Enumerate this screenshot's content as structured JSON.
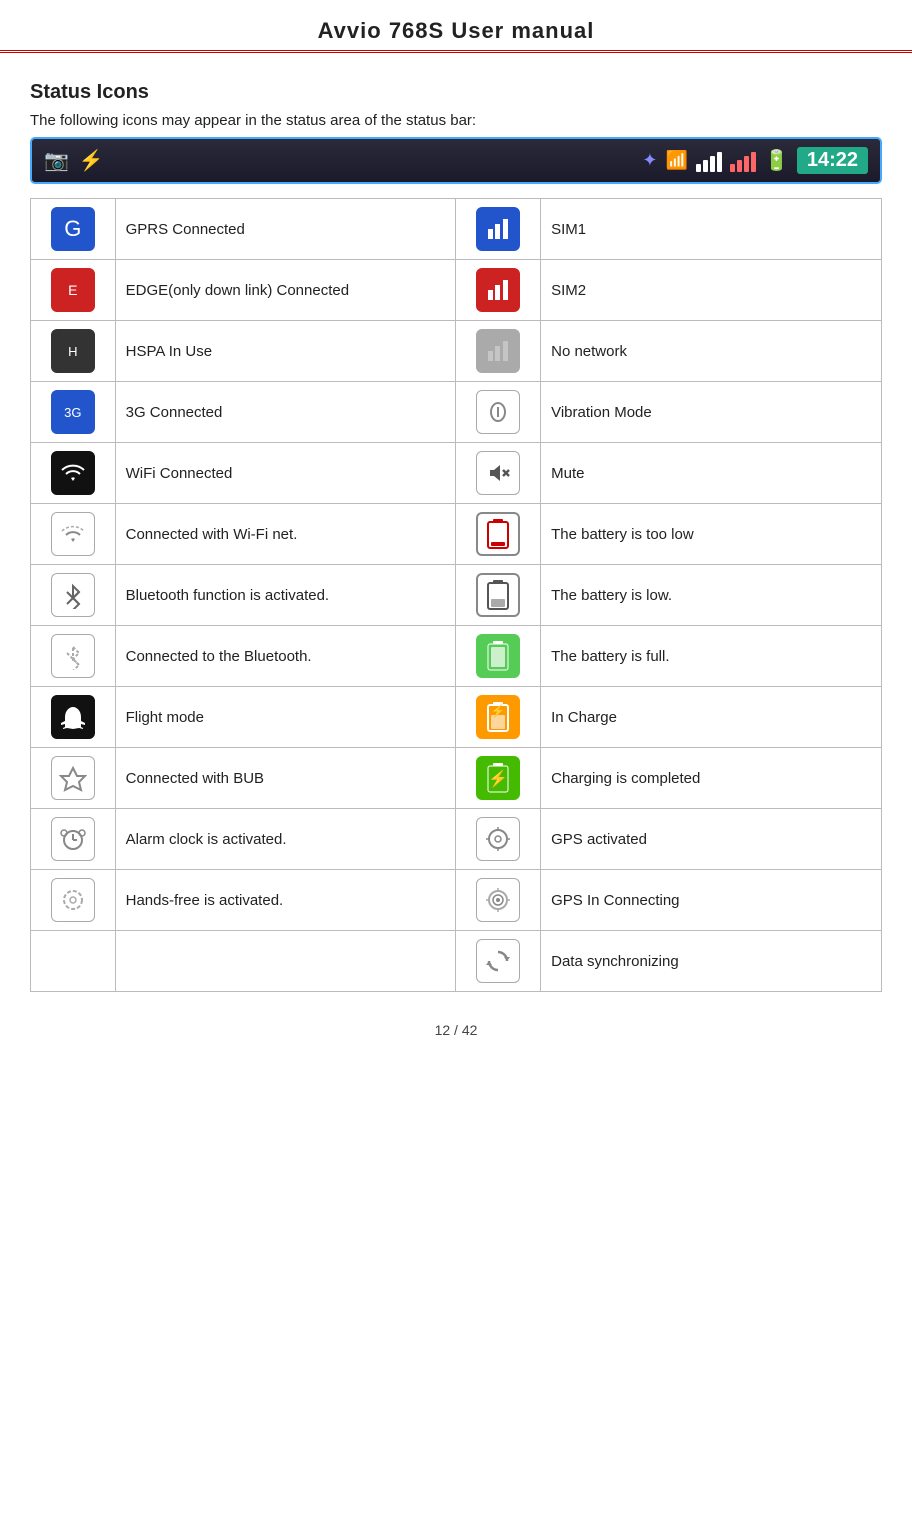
{
  "header": {
    "title": "Avvio 768S",
    "subtitle": "User manual"
  },
  "section": {
    "title": "Status Icons",
    "intro": "The following icons may appear in the status area of the status bar:"
  },
  "status_bar": {
    "time": "14:22"
  },
  "table": {
    "rows": [
      {
        "left_label": "GPRS Connected",
        "right_label": "SIM1"
      },
      {
        "left_label": "EDGE(only down link) Connected",
        "right_label": "SIM2"
      },
      {
        "left_label": "HSPA In Use",
        "right_label": "No network"
      },
      {
        "left_label": "3G Connected",
        "right_label": "Vibration Mode"
      },
      {
        "left_label": "WiFi Connected",
        "right_label": "Mute"
      },
      {
        "left_label": "Connected with Wi-Fi net.",
        "right_label": "The battery is too low"
      },
      {
        "left_label": "Bluetooth function is activated.",
        "right_label": "The battery is low."
      },
      {
        "left_label": "Connected to the Bluetooth.",
        "right_label": "The battery is full."
      },
      {
        "left_label": "Flight mode",
        "right_label": "In Charge"
      },
      {
        "left_label": "Connected with BUB",
        "right_label": "Charging is completed"
      },
      {
        "left_label": "Alarm clock is activated.",
        "right_label": "GPS activated"
      },
      {
        "left_label": "Hands-free is activated.",
        "right_label": "GPS In Connecting"
      },
      {
        "left_label": "",
        "right_label": "Data synchronizing"
      }
    ]
  },
  "footer": {
    "page": "12 / 42"
  }
}
